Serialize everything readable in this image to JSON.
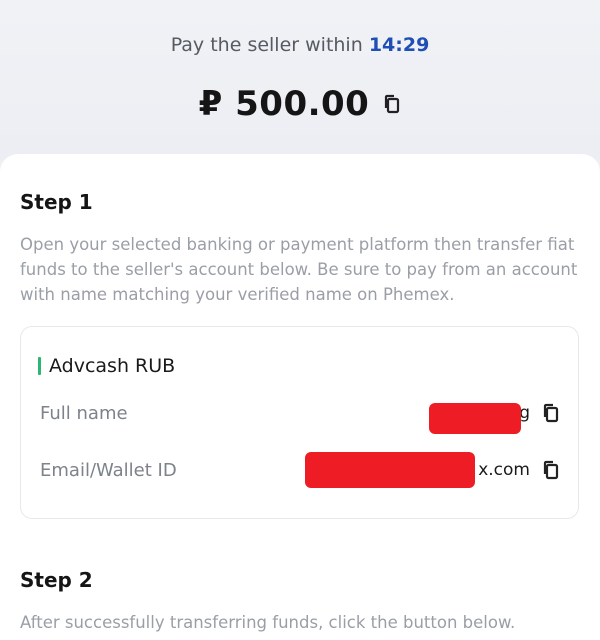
{
  "header": {
    "timer_prefix": "Pay the seller within",
    "timer_value": "14:29",
    "amount": "₽ 500.00"
  },
  "steps": [
    {
      "title": "Step 1",
      "description": "Open your selected banking or payment platform then transfer fiat funds to the seller's account below. Be sure to pay from an account with name matching your verified name on Phemex."
    },
    {
      "title": "Step 2",
      "description": "After successfully transferring funds, click the button below."
    }
  ],
  "payment": {
    "method": "Advcash RUB",
    "fields": [
      {
        "label": "Full name",
        "value_visible": "g"
      },
      {
        "label": "Email/Wallet ID",
        "value_visible": "x.com"
      }
    ]
  },
  "colors": {
    "accent_blue": "#1f4fb5",
    "method_bar": "#2bb673",
    "redaction": "#ee1c25"
  },
  "icons": [
    "copy-icon"
  ]
}
